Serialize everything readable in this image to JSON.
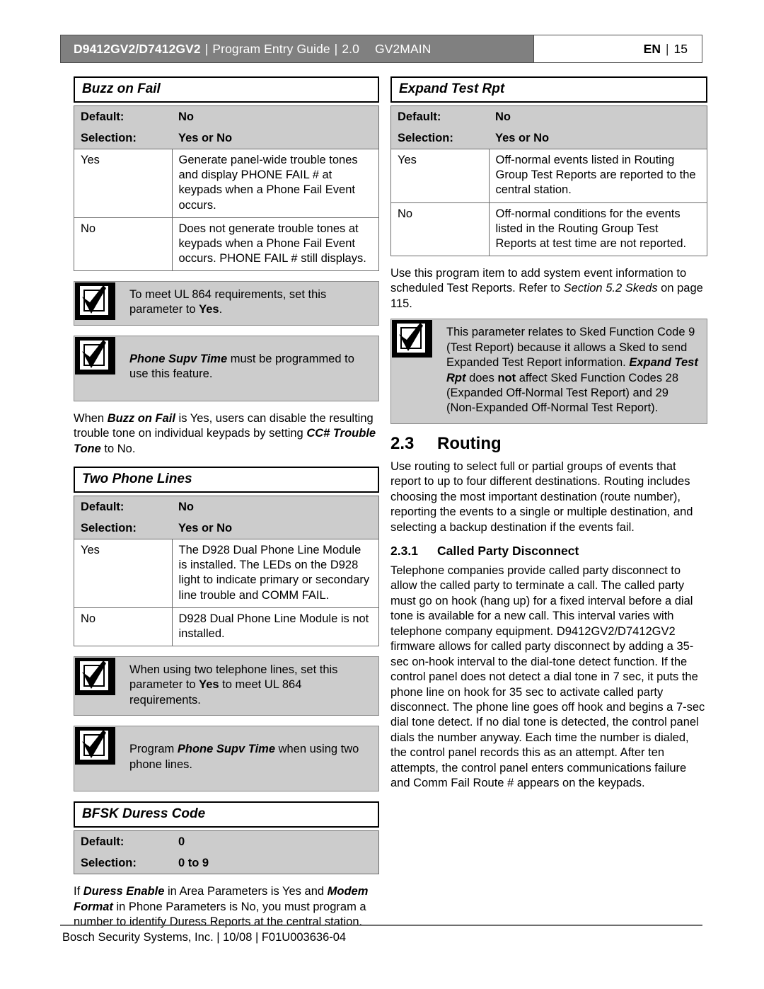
{
  "header": {
    "product": "D9412GV2/D7412GV2",
    "separator": "|",
    "guide": "Program Entry Guide",
    "version": "2.0",
    "module": "GV2MAIN",
    "language": "EN",
    "page_number": "15"
  },
  "left_column": {
    "buzz_on_fail": {
      "title": "Buzz on Fail",
      "default_label": "Default:",
      "default_value": "No",
      "selection_label": "Selection:",
      "selection_value": "Yes or No",
      "rows": [
        {
          "key": "Yes",
          "value": "Generate panel-wide trouble tones and display PHONE FAIL # at keypads when a Phone Fail Event occurs."
        },
        {
          "key": "No",
          "value": "Does not generate trouble tones at keypads when a Phone Fail Event occurs. PHONE FAIL # still displays."
        }
      ],
      "note1_a": "To meet UL 864 requirements, set this parameter to ",
      "note1_b": "Yes",
      "note1_c": ".",
      "note2_a": "Phone Supv Time",
      "note2_b": " must be programmed to use this feature.",
      "para_a": "When ",
      "para_b": "Buzz on Fail",
      "para_c": " is Yes, users can disable the resulting trouble tone on individual keypads by setting ",
      "para_d": "CC# Trouble Tone",
      "para_e": " to No."
    },
    "two_phone_lines": {
      "title": "Two Phone Lines",
      "default_label": "Default:",
      "default_value": "No",
      "selection_label": "Selection:",
      "selection_value": "Yes or No",
      "rows": [
        {
          "key": "Yes",
          "value": "The D928 Dual Phone Line Module is installed. The LEDs on the D928 light to indicate primary or secondary line trouble and COMM FAIL."
        },
        {
          "key": "No",
          "value": "D928 Dual Phone Line Module is not installed."
        }
      ],
      "note1_a": "When using two telephone lines, set this parameter to ",
      "note1_b": "Yes",
      "note1_c": " to meet UL 864 requirements.",
      "note2_a": "Program ",
      "note2_b": "Phone Supv Time",
      "note2_c": " when using two phone lines."
    },
    "bfsk_duress_code": {
      "title": "BFSK Duress Code",
      "default_label": "Default:",
      "default_value": "0",
      "selection_label": "Selection:",
      "selection_value": "0 to 9",
      "para_a": "If ",
      "para_b": "Duress Enable",
      "para_c": " in Area Parameters is Yes and ",
      "para_d": "Modem Format",
      "para_e": " in Phone Parameters is No, you must program a number to identify Duress Reports at the central station."
    }
  },
  "right_column": {
    "expand_test_rpt": {
      "title": "Expand Test Rpt",
      "default_label": "Default:",
      "default_value": "No",
      "selection_label": "Selection:",
      "selection_value": "Yes or No",
      "rows": [
        {
          "key": "Yes",
          "value": "Off-normal events listed in Routing Group Test Reports are reported to the central station."
        },
        {
          "key": "No",
          "value": "Off-normal conditions for the events listed in the Routing Group Test Reports at test time are not reported."
        }
      ],
      "para_a": "Use this program item to add system event information to scheduled Test Reports. Refer to ",
      "para_b": "Section 5.2 Skeds",
      "para_c": " on page 115.",
      "note_a": "This parameter relates to Sked Function Code 9 (Test Report) because it allows a Sked to send Expanded Test Report information. ",
      "note_b": "Expand Test Rpt",
      "note_c": " does ",
      "note_d": "not",
      "note_e": " affect Sked Function Codes 28 (Expanded Off-Normal Test Report) and 29 (Non-Expanded Off-Normal Test Report)."
    },
    "routing": {
      "number": "2.3",
      "title": "Routing",
      "body": "Use routing to select full or partial groups of events that report to up to four different destinations. Routing includes choosing the most important destination (route number), reporting the events to a single or multiple destination, and selecting a backup destination if the events fail."
    },
    "called_party_disconnect": {
      "number": "2.3.1",
      "title": "Called Party Disconnect",
      "body": "Telephone companies provide called party disconnect to allow the called party to terminate a call. The called party must go on hook (hang up) for a fixed interval before a dial tone is available for a new call. This interval varies with telephone company equipment. D9412GV2/D7412GV2 firmware allows for called party disconnect by adding a 35-sec on-hook interval to the dial-tone detect function. If the control panel does not detect a dial tone in 7 sec, it puts the phone line on hook for 35 sec to activate called party disconnect. The phone line goes off hook and begins a 7-sec dial tone detect. If no dial tone is detected, the control panel dials the number anyway. Each time the number is dialed, the control panel records this as an attempt. After ten attempts, the control panel enters communications failure and Comm Fail Route # appears on the keypads."
    }
  },
  "footer": {
    "text": "Bosch Security Systems, Inc. | 10/08 | F01U003636-04"
  },
  "colors": {
    "header_bar": "#808080",
    "table_header": "#cccccc",
    "note_bg": "#cccccc",
    "rule": "#6e6e6e"
  }
}
